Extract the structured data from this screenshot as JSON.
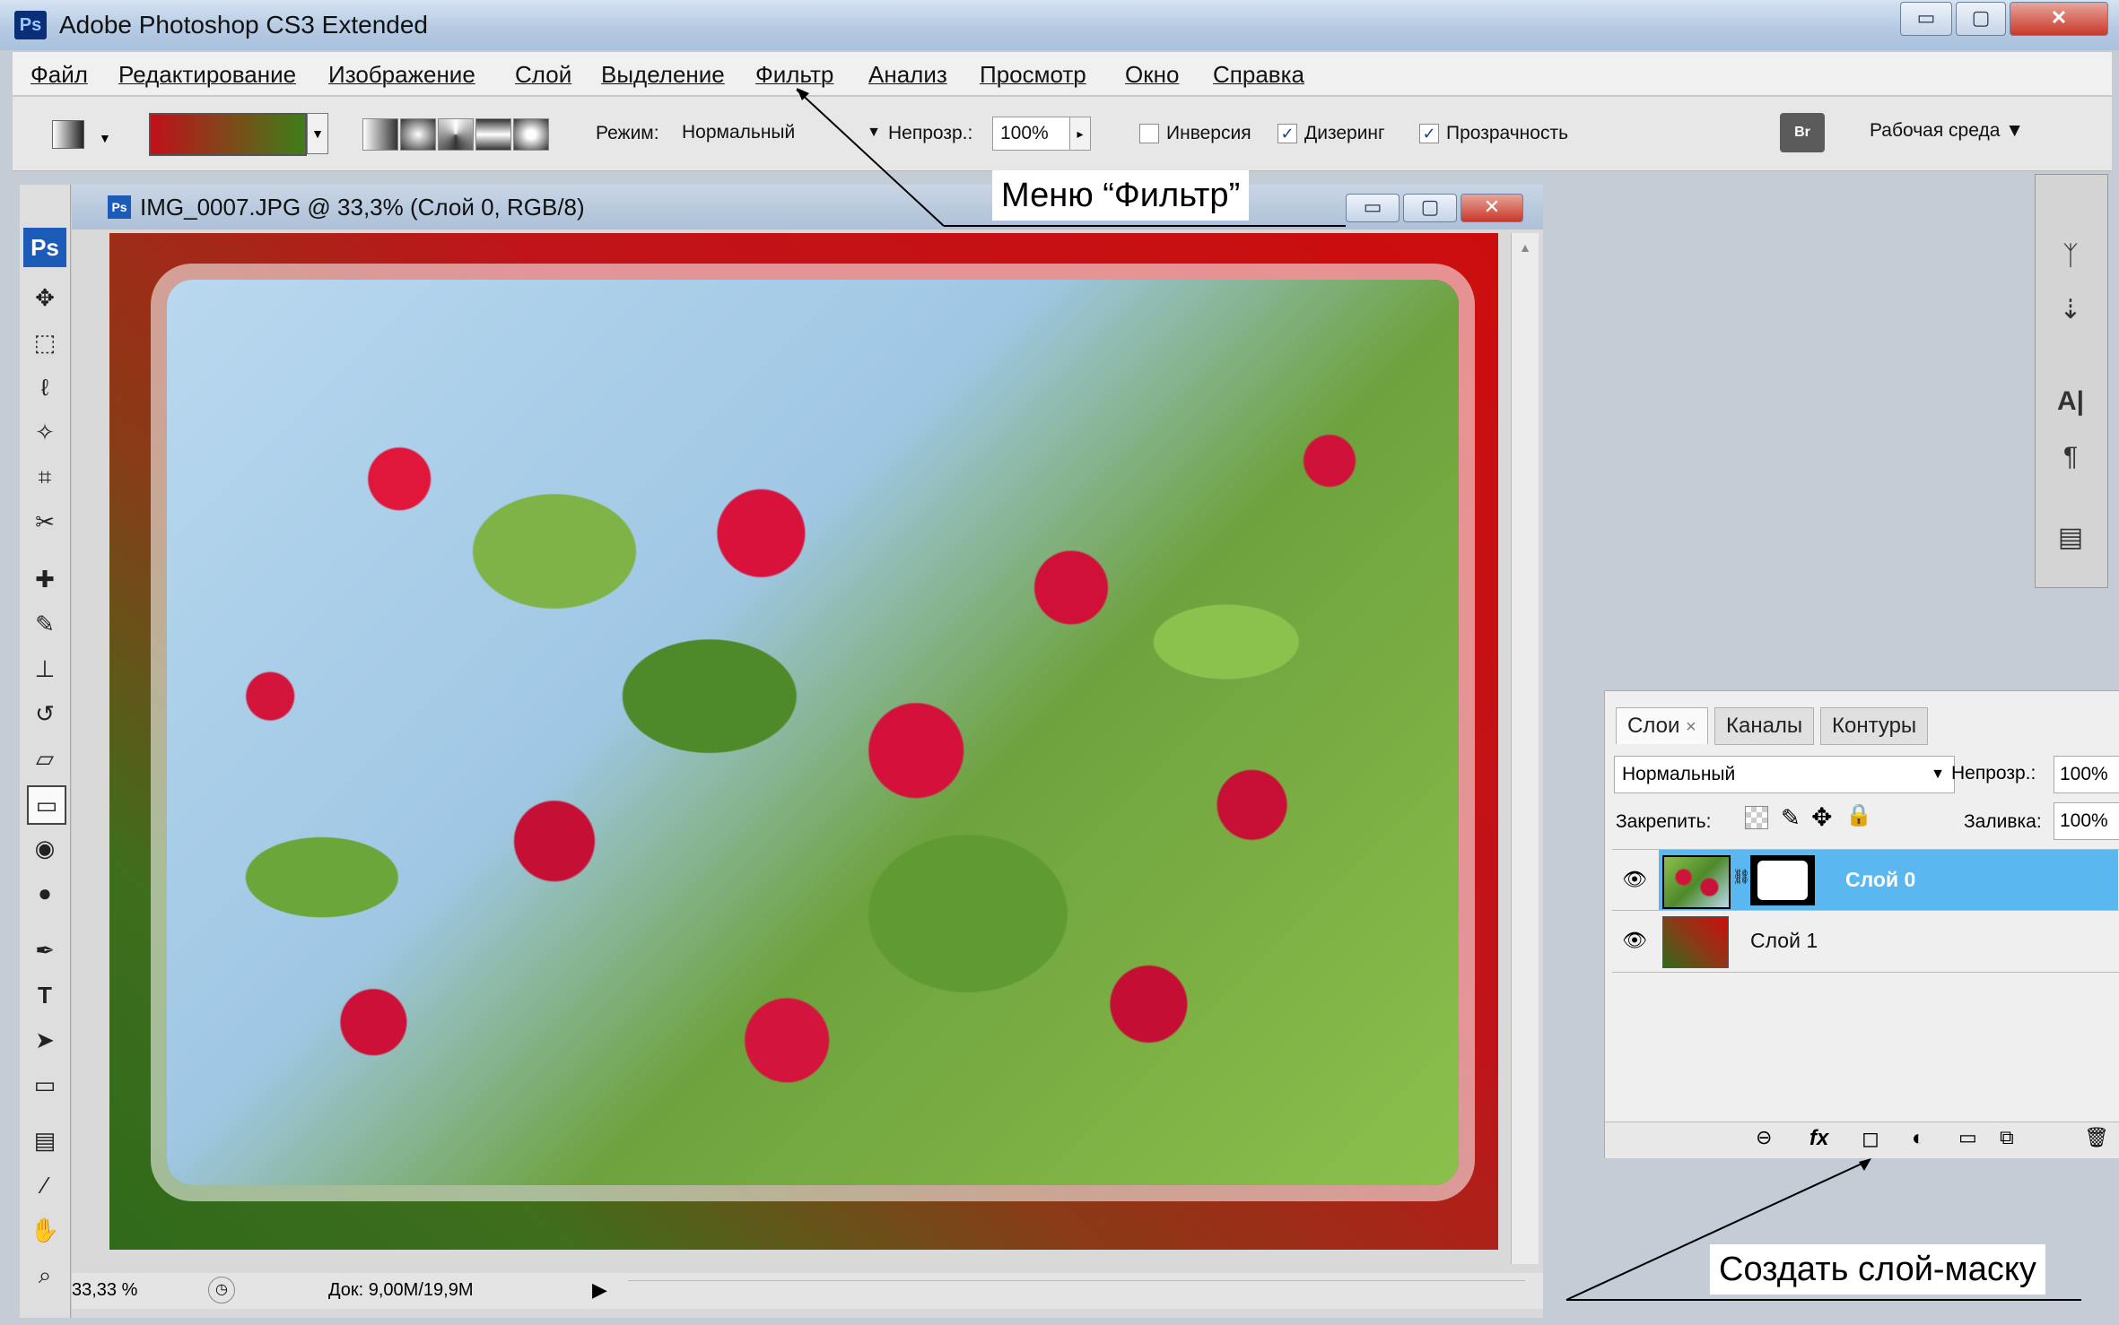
{
  "window": {
    "app_icon": "Ps",
    "title": "Adobe Photoshop CS3 Extended",
    "controls": {
      "minimize": "▭",
      "maximize": "▢",
      "close": "✕"
    }
  },
  "menu": [
    "Файл",
    "Редактирование",
    "Изображение",
    "Слой",
    "Выделение",
    "Фильтр",
    "Анализ",
    "Просмотр",
    "Окно",
    "Справка"
  ],
  "options_bar": {
    "gradient_colors": {
      "from": "#c0111a",
      "to": "#3e7e18"
    },
    "mode_label": "Режим:",
    "mode_value": "Нормальный",
    "opacity_label": "Непрозр.:",
    "opacity_value": "100%",
    "reverse_label": "Инверсия",
    "dither_label": "Дизеринг",
    "transparency_label": "Прозрачность",
    "workspace_label": "Рабочая среда ▼",
    "bridge_icon": "Br"
  },
  "document": {
    "icon": "Ps",
    "title": "IMG_0007.JPG @ 33,3% (Слой 0, RGB/8)",
    "zoom": "33,33 %",
    "doc_info": "Док: 9,00M/19,9M"
  },
  "tools": {
    "ps_logo": "Ps",
    "move": "✥",
    "marquee": "⬚",
    "lasso": "ℓ",
    "wand": "✧",
    "crop": "⌗",
    "eyedropper_slice": "✂",
    "healing": "✚",
    "brush": "✎",
    "stamp": "⊥",
    "history_brush": "↺",
    "eraser": "▱",
    "gradient": "▭",
    "blur": "◉",
    "dodge": "●",
    "pen": "✒",
    "type": "T",
    "path_select": "➤",
    "shape": "▭",
    "notes": "▤",
    "eyedropper": "⁄",
    "hand": "✋",
    "zoom": "⌕"
  },
  "dock": {
    "icons": [
      "ᛉ",
      "⇣",
      "A|",
      "¶",
      "▤"
    ]
  },
  "layers_panel": {
    "tabs": [
      "Слои",
      "Каналы",
      "Контуры"
    ],
    "tab_close": "×",
    "blend_mode": "Нормальный",
    "opacity_label": "Непрозр.:",
    "opacity_value": "100%",
    "lock_label": "Закрепить:",
    "fill_label": "Заливка:",
    "fill_value": "100%",
    "layers": [
      {
        "name": "Слой 0",
        "selected": true
      },
      {
        "name": "Слой 1",
        "selected": false
      }
    ],
    "footer_icons": [
      "⊖",
      "fx",
      "◻",
      "◐",
      "▭",
      "⧉",
      "🗑"
    ]
  },
  "callouts": {
    "filter_menu": "Меню “Фильтр”",
    "create_mask": "Создать слой-маску"
  },
  "colors": {
    "selection": "#5bb7f0",
    "accent_red": "#c0111a",
    "accent_green": "#3e7e18"
  }
}
